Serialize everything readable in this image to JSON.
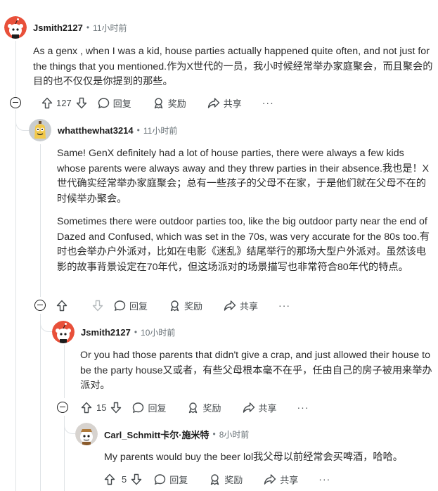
{
  "comments": [
    {
      "username": "Jsmith2127",
      "time": "11小时前",
      "paragraphs": [
        "As a genx , when I was a kid, house parties actually happened quite often, and not just for the things that you mentioned.作为X世代的一员，我小时候经常举办家庭聚会，而且聚会的目的也不仅仅是你提到的那些。"
      ],
      "votes": "127",
      "reply_label": "回复",
      "award_label": "奖励",
      "share_label": "共享",
      "more_label": "···"
    },
    {
      "username": "whatthewhat3214",
      "time": "11小时前",
      "paragraphs": [
        "Same! GenX definitely had a lot of house parties, there were always a few kids whose parents were always away and they threw parties in their absence.我也是！X世代确实经常举办家庭聚会；总有一些孩子的父母不在家，于是他们就在父母不在的时候举办聚会。",
        "Sometimes there were outdoor parties too, like the big outdoor party near the end of Dazed and Confused, which was set in the 70s, was very accurate for the 80s too.有时也会举办户外派对，比如在电影《迷乱》结尾举行的那场大型户外派对。虽然该电影的故事背景设定在70年代，但这场派对的场景描写也非常符合80年代的特点。"
      ],
      "votes": "",
      "reply_label": "回复",
      "award_label": "奖励",
      "share_label": "共享",
      "more_label": "···"
    },
    {
      "username": "Jsmith2127",
      "time": "10小时前",
      "paragraphs": [
        "Or you had those parents that didn't give a crap, and just allowed their house to be the party house又或者，有些父母根本毫不在乎，任由自己的房子被用来举办派对。"
      ],
      "votes": "15",
      "reply_label": "回复",
      "award_label": "奖励",
      "share_label": "共享",
      "more_label": "···"
    },
    {
      "username": "Carl_Schmitt卡尔·施米特",
      "time": "8小时前",
      "paragraphs": [
        "My parents would buy the beer lol我父母以前经常会买啤酒，哈哈。"
      ],
      "votes": "5",
      "reply_label": "回复",
      "award_label": "奖励",
      "share_label": "共享",
      "more_label": "···"
    }
  ],
  "separator": "•",
  "icons": {
    "upvote": "arrow-up-icon",
    "downvote": "arrow-down-icon",
    "reply": "speech-bubble-icon",
    "award": "award-ribbon-icon",
    "share": "share-arrow-icon",
    "collapse": "collapse-minus-icon",
    "avatar": "reddit-snoo-avatar"
  },
  "colors": {
    "text": "#1c1c1c",
    "meta": "#6b7479",
    "thread_line": "#dfe3e6",
    "avatar_red_bg": "#e8503a",
    "avatar_gray_bg": "#c9cdd0",
    "avatar_yellow_bg": "#f2c94c"
  }
}
